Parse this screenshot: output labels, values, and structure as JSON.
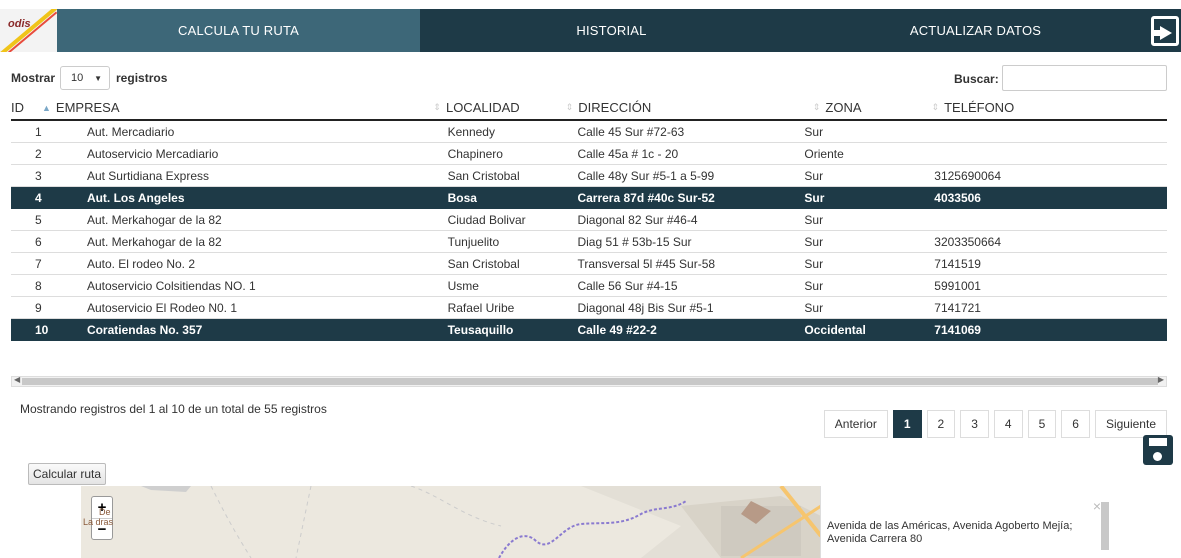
{
  "nav": {
    "logo_text": "odis",
    "tabs": [
      "CALCULA TU RUTA",
      "HISTORIAL",
      "ACTUALIZAR DATOS"
    ]
  },
  "controls": {
    "show_label": "Mostrar",
    "show_value": "10",
    "records_label": "registros",
    "search_label": "Buscar:",
    "search_value": ""
  },
  "table": {
    "headers": [
      "ID",
      "EMPRESA",
      "LOCALIDAD",
      "DIRECCIÓN",
      "ZONA",
      "TELÉFONO"
    ],
    "rows": [
      {
        "id": "1",
        "empresa": "Aut. Mercadiario",
        "localidad": "Kennedy",
        "direccion": "Calle 45 Sur #72-63",
        "zona": "Sur",
        "telefono": "",
        "selected": false
      },
      {
        "id": "2",
        "empresa": "Autoservicio Mercadiario",
        "localidad": "Chapinero",
        "direccion": "Calle 45a # 1c - 20",
        "zona": "Oriente",
        "telefono": "",
        "selected": false
      },
      {
        "id": "3",
        "empresa": "Aut Surtidiana Express",
        "localidad": "San Cristobal",
        "direccion": "Calle 48y Sur #5-1 a 5-99",
        "zona": "Sur",
        "telefono": "3125690064",
        "selected": false
      },
      {
        "id": "4",
        "empresa": "Aut. Los Angeles",
        "localidad": "Bosa",
        "direccion": "Carrera 87d #40c Sur-52",
        "zona": "Sur",
        "telefono": "4033506",
        "selected": true
      },
      {
        "id": "5",
        "empresa": "Aut. Merkahogar de la 82",
        "localidad": "Ciudad Bolivar",
        "direccion": "Diagonal 82 Sur #46-4",
        "zona": "Sur",
        "telefono": "",
        "selected": false
      },
      {
        "id": "6",
        "empresa": "Aut. Merkahogar de la 82",
        "localidad": "Tunjuelito",
        "direccion": "Diag 51 # 53b-15 Sur",
        "zona": "Sur",
        "telefono": "3203350664",
        "selected": false
      },
      {
        "id": "7",
        "empresa": "Auto. El rodeo No. 2",
        "localidad": "San Cristobal",
        "direccion": "Transversal 5l #45 Sur-58",
        "zona": "Sur",
        "telefono": "7141519",
        "selected": false
      },
      {
        "id": "8",
        "empresa": "Autoservicio Colsitiendas NO. 1",
        "localidad": "Usme",
        "direccion": "Calle 56 Sur #4-15",
        "zona": "Sur",
        "telefono": "5991001",
        "selected": false
      },
      {
        "id": "9",
        "empresa": "Autoservicio El Rodeo N0. 1",
        "localidad": "Rafael Uribe",
        "direccion": "Diagonal 48j Bis Sur #5-1",
        "zona": "Sur",
        "telefono": "7141721",
        "selected": false
      },
      {
        "id": "10",
        "empresa": "Coratiendas No. 357",
        "localidad": "Teusaquillo",
        "direccion": "Calle 49 #22-2",
        "zona": "Occidental",
        "telefono": "7141069",
        "selected": true
      }
    ]
  },
  "info_text": "Mostrando registros del 1 al 10 de un total de 55 registros",
  "pagination": {
    "prev": "Anterior",
    "pages": [
      "1",
      "2",
      "3",
      "4",
      "5",
      "6"
    ],
    "active": "1",
    "next": "Siguiente"
  },
  "calc_button": "Calcular ruta",
  "map": {
    "zoom_in": "+",
    "zoom_out": "−",
    "place_label_1": "De",
    "place_label_2": "La   dras",
    "popup_close": "×",
    "popup_text": "Avenida de las Américas, Avenida Agoberto Mejía; Avenida Carrera 80"
  },
  "icons": [
    "logout-icon",
    "save-icon",
    "sort-icon"
  ]
}
